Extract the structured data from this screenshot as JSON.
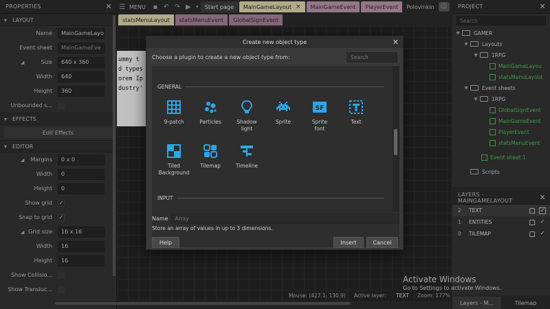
{
  "properties": {
    "title": "PROPERTIES",
    "sections": {
      "layout": "LAYOUT",
      "effects": "EFFECTS",
      "editor": "EDITOR"
    },
    "layout_rows": {
      "name_label": "Name",
      "name_value": "MainGameLayou",
      "event_sheet_label": "Event sheet",
      "event_sheet_value": "MainGameEve",
      "size_label": "Size",
      "size_value": "640 x 360",
      "width_label": "Width",
      "width_value": "640",
      "height_label": "Height",
      "height_value": "360",
      "unbounded_label": "Unbounded s..."
    },
    "effects_button": "Edit Effects",
    "editor_rows": {
      "margins_label": "Margins",
      "margins_value": "0 x 0",
      "m_width_label": "Width",
      "m_width_value": "0",
      "m_height_label": "Height",
      "m_height_value": "0",
      "show_grid_label": "Show grid",
      "snap_label": "Snap to grid",
      "grid_size_label": "Grid size",
      "grid_size_value": "16 x 16",
      "g_width_label": "Width",
      "g_width_value": "16",
      "g_height_label": "Height",
      "g_height_value": "16",
      "show_collision_label": "Show Collisio...",
      "show_translucent_label": "Show Transluc..."
    }
  },
  "toolbar": {
    "menu_label": "MENU",
    "tabs": [
      "Start page",
      "MainGameLayout",
      "MainGameEvent",
      "PlayerEvent",
      "Polovinkin"
    ],
    "tabs_row2": [
      "statsMenuLayout",
      "statsMenuEvent",
      "GlobalSignEvent"
    ]
  },
  "canvas_text": [
    "ummy t",
    "d types",
    "orem Ip",
    "dustry'"
  ],
  "status": {
    "mouse_label": "Mouse: (427.1, 130.9)",
    "active_layer_label": "Active layer:",
    "active_layer_value": "TEXT",
    "zoom_label": "Zoom: 177%"
  },
  "project": {
    "title": "PROJECT",
    "search_placeholder": "Search",
    "root": "GAMER",
    "layouts": "Layouts",
    "layouts_folder": "1RPG",
    "layout_items": [
      "MainGameLayou",
      "statsMenuLayout"
    ],
    "event_sheets": "Event sheets",
    "events_folder": "1RPG",
    "event_items": [
      "GlobalSignEvent",
      "MainGameEvent",
      "PlayerEvent",
      "statsMenuEvent"
    ],
    "event_sheet_1": "Event sheet 1",
    "scripts": "Scripts"
  },
  "layers": {
    "title": "LAYERS - MAINGAMELAYOUT",
    "rows": [
      {
        "index": "2",
        "name": "TEXT"
      },
      {
        "index": "1",
        "name": "ENTITIES"
      },
      {
        "index": "0",
        "name": "TILEMAP"
      }
    ],
    "bottom_tabs": [
      "Layers - M...",
      "Tilemap"
    ]
  },
  "dialog": {
    "title": "Create new object type",
    "prompt": "Choose a plugin to create a new object type from:",
    "search_placeholder": "Search",
    "category_general": "GENERAL",
    "category_input": "INPUT",
    "plugins": [
      {
        "label": "9-patch",
        "icon": "nine-patch-icon"
      },
      {
        "label": "Particles",
        "icon": "particles-icon"
      },
      {
        "label": "Shadow light",
        "icon": "shadow-light-icon"
      },
      {
        "label": "Sprite",
        "icon": "sprite-icon"
      },
      {
        "label": "Sprite font",
        "icon": "sprite-font-icon"
      },
      {
        "label": "Text",
        "icon": "text-icon"
      },
      {
        "label": "Tiled Background",
        "icon": "tiled-background-icon"
      },
      {
        "label": "Tilemap",
        "icon": "tilemap-icon"
      },
      {
        "label": "Timeline",
        "icon": "timeline-icon"
      }
    ],
    "name_label": "Name",
    "name_placeholder": "Array",
    "description": "Store an array of values in up to 3 dimensions.",
    "help_button": "Help",
    "insert_button": "Insert",
    "cancel_button": "Cancel"
  },
  "watermark": {
    "line1": "Activate Windows",
    "line2": "Go to Settings to activate Windows."
  },
  "colors": {
    "accent_blue": "#29a7e6",
    "tree_green": "#4bbd55",
    "layout_tab": "#d8d0a8",
    "event_tab": "#b890a8"
  }
}
